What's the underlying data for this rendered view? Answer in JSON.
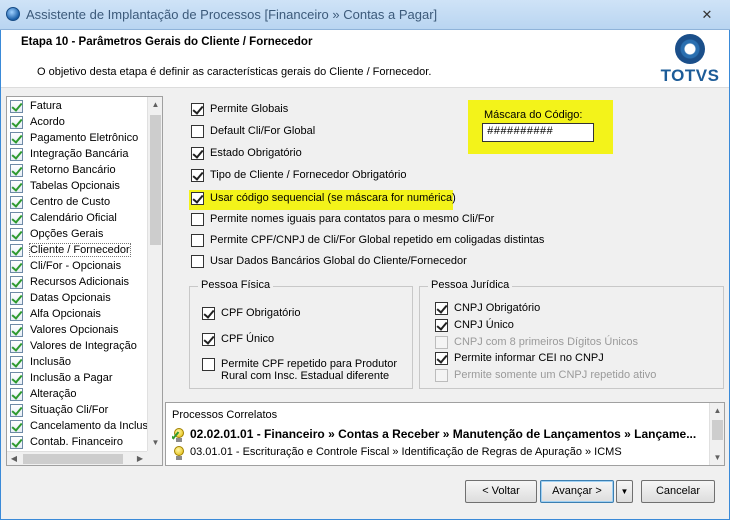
{
  "window": {
    "title": "Assistente de Implantação de Processos [Financeiro » Contas a Pagar]",
    "close_symbol": "✕"
  },
  "header": {
    "step_title": "Etapa 10 - Parâmetros Gerais do Cliente / Fornecedor",
    "description": "O objetivo desta etapa é definir as características gerais do Cliente / Fornecedor.",
    "logo_text": "TOTVS"
  },
  "sidebar": {
    "selected_index": 9,
    "items": [
      "Fatura",
      "Acordo",
      "Pagamento Eletrônico",
      "Integração Bancária",
      "Retorno Bancário",
      "Tabelas Opcionais",
      "Centro de Custo",
      "Calendário Oficial",
      "Opções Gerais",
      "Cliente / Fornecedor",
      "Cli/For - Opcionais",
      "Recursos Adicionais",
      "Datas Opcionais",
      "Alfa Opcionais",
      "Valores Opcionais",
      "Valores de Integração",
      "Inclusão",
      "Inclusão a Pagar",
      "Alteração",
      "Situação Cli/For",
      "Cancelamento da Inclusã",
      "Contab. Financeiro"
    ]
  },
  "options": [
    {
      "label": "Permite Globais",
      "checked": true
    },
    {
      "label": "Default Cli/For Global",
      "checked": false
    },
    {
      "label": "Estado Obrigatório",
      "checked": true
    },
    {
      "label": "Tipo de Cliente / Fornecedor Obrigatório",
      "checked": true
    },
    {
      "label": "Usar código sequencial (se máscara for numérica)",
      "checked": true,
      "highlighted": true
    },
    {
      "label": "Permite nomes iguais para contatos para o mesmo Cli/For",
      "checked": false
    },
    {
      "label": "Permite CPF/CNPJ de Cli/For Global repetido em coligadas distintas",
      "checked": false
    },
    {
      "label": "Usar Dados Bancários Global do Cliente/Fornecedor",
      "checked": false
    }
  ],
  "mask": {
    "label": "Máscara do Código:",
    "value": "##########"
  },
  "pessoa_fisica": {
    "title": "Pessoa Física",
    "items": [
      {
        "label": "CPF Obrigatório",
        "checked": true
      },
      {
        "label": "CPF Único",
        "checked": true
      },
      {
        "label_line1": "Permite CPF repetido para Produtor",
        "label_line2": "Rural com Insc. Estadual diferente",
        "checked": false
      }
    ]
  },
  "pessoa_juridica": {
    "title": "Pessoa Jurídica",
    "items": [
      {
        "label": "CNPJ Obrigatório",
        "checked": true,
        "enabled": true
      },
      {
        "label": "CNPJ Único",
        "checked": true,
        "enabled": true
      },
      {
        "label": "CNPJ com 8 primeiros Dígitos Únicos",
        "checked": false,
        "enabled": false
      },
      {
        "label": "Permite informar CEI no CNPJ",
        "checked": true,
        "enabled": true
      },
      {
        "label": "Permite somente um CNPJ repetido ativo",
        "checked": false,
        "enabled": false
      }
    ]
  },
  "related": {
    "title": "Processos Correlatos",
    "rows": [
      {
        "text": "02.02.01.01 - Financeiro » Contas a Receber » Manutenção de Lançamentos » Lançame...",
        "bold": true,
        "icon": "lightbulb-check-icon"
      },
      {
        "text": "03.01.01 - Escrituração e Controle Fiscal » Identificação de Regras de Apuração » ICMS",
        "bold": false,
        "icon": "lightbulb-icon"
      }
    ]
  },
  "buttons": {
    "back": "< Voltar",
    "next": "Avançar >",
    "dropdown": "▼",
    "cancel": "Cancelar"
  }
}
